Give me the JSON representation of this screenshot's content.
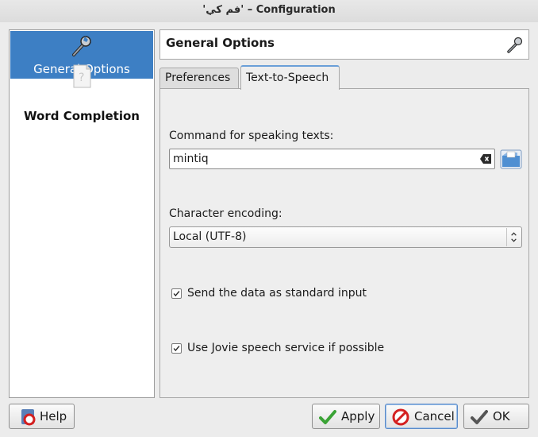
{
  "window": {
    "title": "'فم كي' – Configuration"
  },
  "sidebar": {
    "items": [
      {
        "label": "General Options",
        "selected": true,
        "icon": "wrench-icon"
      },
      {
        "label": "Word Completion",
        "selected": false,
        "icon": "document-icon"
      }
    ]
  },
  "header": {
    "title": "General Options",
    "icon": "wrench-icon"
  },
  "tabs": [
    {
      "label": "Preferences",
      "active": false
    },
    {
      "label": "Text-to-Speech",
      "active": true
    }
  ],
  "speech": {
    "command_label": "Command for speaking texts:",
    "command_value": "mintiq",
    "encoding_label": "Character encoding:",
    "encoding_value": "Local (UTF-8)",
    "stdin_label": "Send the data as standard input",
    "stdin_checked": true,
    "jovie_label": "Use Jovie speech service if possible",
    "jovie_checked": true
  },
  "buttons": {
    "help": "Help",
    "apply": "Apply",
    "cancel": "Cancel",
    "ok": "OK"
  },
  "colors": {
    "selection": "#3d7fc4",
    "apply_check": "#3aa335",
    "cancel_red": "#d42020"
  }
}
